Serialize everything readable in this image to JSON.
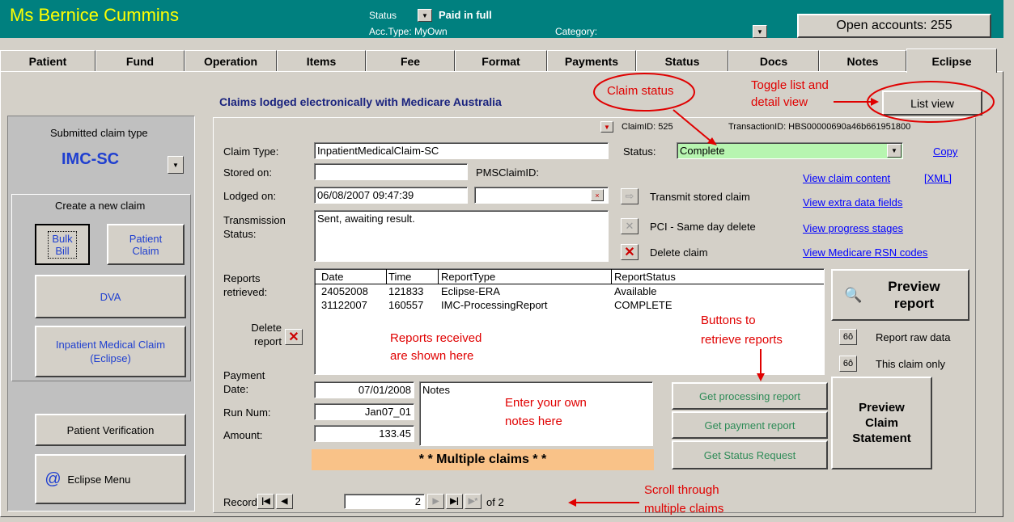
{
  "header": {
    "patient_name": "Ms Bernice Cummins",
    "status_label": "Status",
    "status_value": "Paid in full",
    "acc_type": "Acc.Type: MyOwn",
    "category_label": "Category:",
    "open_accounts": "Open accounts: 255"
  },
  "tabs": [
    "Patient",
    "Fund",
    "Operation",
    "Items",
    "Fee",
    "Format",
    "Payments",
    "Status",
    "Docs",
    "Notes",
    "Eclipse"
  ],
  "active_tab": "Eclipse",
  "sidebar": {
    "submitted_label": "Submitted claim type",
    "submitted_value": "IMC-SC",
    "create_label": "Create a new claim",
    "bulk_bill": "Bulk Bill",
    "patient_claim": "Patient Claim",
    "dva": "DVA",
    "inpatient": "Inpatient Medical Claim (Eclipse)",
    "patient_verification": "Patient Verification",
    "eclipse_menu": "Eclipse Menu"
  },
  "main": {
    "heading": "Claims lodged electronically with Medicare Australia",
    "list_view": "List view",
    "claim_id": "ClaimID: 525",
    "transaction_id": "TransactionID: HBS00000690a46b661951800",
    "claim_type_label": "Claim Type:",
    "claim_type_value": "InpatientMedicalClaim-SC",
    "stored_label": "Stored on:",
    "stored_value": "",
    "pms_label": "PMSClaimID:",
    "lodged_label": "Lodged on:",
    "lodged_value": "06/08/2007 09:47:39",
    "transmission_label": "Transmission Status:",
    "transmission_value": "Sent, awaiting result.",
    "status_label": "Status:",
    "status_value": "Complete",
    "copy": "Copy",
    "transmit": "Transmit stored claim",
    "pci": "PCI - Same day delete",
    "delete_claim": "Delete claim",
    "reports_label": "Reports retrieved:",
    "delete_report": "Delete report",
    "payment_date_label": "Payment Date:",
    "payment_date": "07/01/2008",
    "run_num_label": "Run Num:",
    "run_num": "Jan07_01",
    "amount_label": "Amount:",
    "amount": "133.45",
    "notes_label": "Notes",
    "multiple": "* * Multiple claims * *",
    "get_processing": "Get processing report",
    "get_payment": "Get payment report",
    "get_status": "Get Status Request",
    "preview_report": "Preview report",
    "report_raw": "Report raw data",
    "this_claim": "This claim only",
    "preview_statement": "Preview Claim Statement",
    "record_label": "Record:",
    "record_value": "2",
    "record_of": "of 2"
  },
  "links": [
    "View claim content",
    "[XML]",
    "View extra data fields",
    "View progress stages",
    "View Medicare RSN codes"
  ],
  "reports_table": {
    "columns": [
      "Date",
      "Time",
      "ReportType",
      "ReportStatus"
    ],
    "rows": [
      [
        "24052008",
        "121833",
        "Eclipse-ERA",
        "Available"
      ],
      [
        "31122007",
        "160557",
        "IMC-ProcessingReport",
        "COMPLETE"
      ]
    ]
  },
  "annotations": {
    "claim_status": "Claim status",
    "toggle_1": "Toggle list and",
    "toggle_2": "detail view",
    "reports_received_1": "Reports received",
    "reports_received_2": "are shown here",
    "buttons_retrieve_1": "Buttons to",
    "buttons_retrieve_2": "retrieve reports",
    "enter_notes_1": "Enter your own",
    "enter_notes_2": "notes here",
    "scroll_1": "Scroll through",
    "scroll_2": "multiple claims"
  },
  "colors": {
    "header_bg": "#00807f",
    "name_yellow": "#ffff00",
    "status_green": "#b7f5b0",
    "multiple_bg": "#f9c288",
    "annotation_red": "#e00000",
    "link_blue": "#0000ff"
  }
}
